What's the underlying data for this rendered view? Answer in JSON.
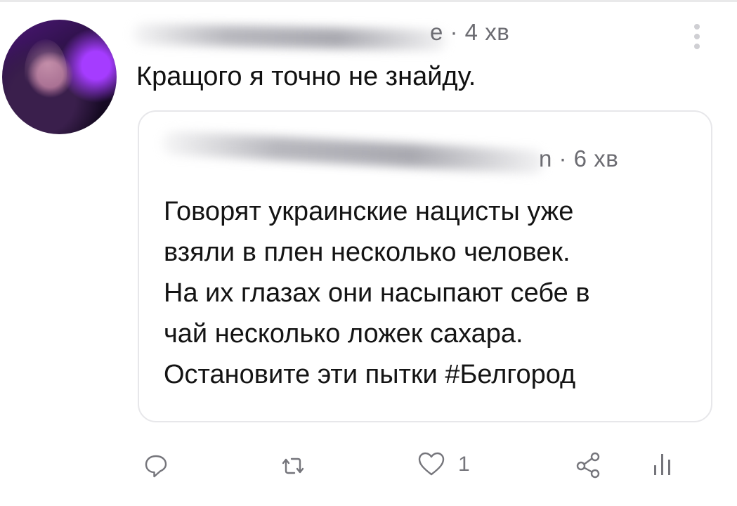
{
  "tweet": {
    "time": "e · 4 хв",
    "text": "Кращого я точно не знайду."
  },
  "quoted_tweet": {
    "time": "n · 6 хв",
    "lines": [
      "Говорят украинские нацисты уже",
      "взяли в плен несколько человек.",
      "На их глазах они насыпают себе в",
      "чай несколько ложек сахара.",
      "Остановите эти пытки #Белгород"
    ]
  },
  "actions": {
    "reply_icon": "reply-bubble-icon",
    "retweet_icon": "retweet-icon",
    "like_icon": "heart-icon",
    "like_count": "1",
    "share_icon": "share-icon",
    "stats_icon": "stats-icon"
  },
  "colors": {
    "background": "#ffffff",
    "text": "#111111",
    "muted": "#6c6c72",
    "border": "#e7e7ea"
  }
}
